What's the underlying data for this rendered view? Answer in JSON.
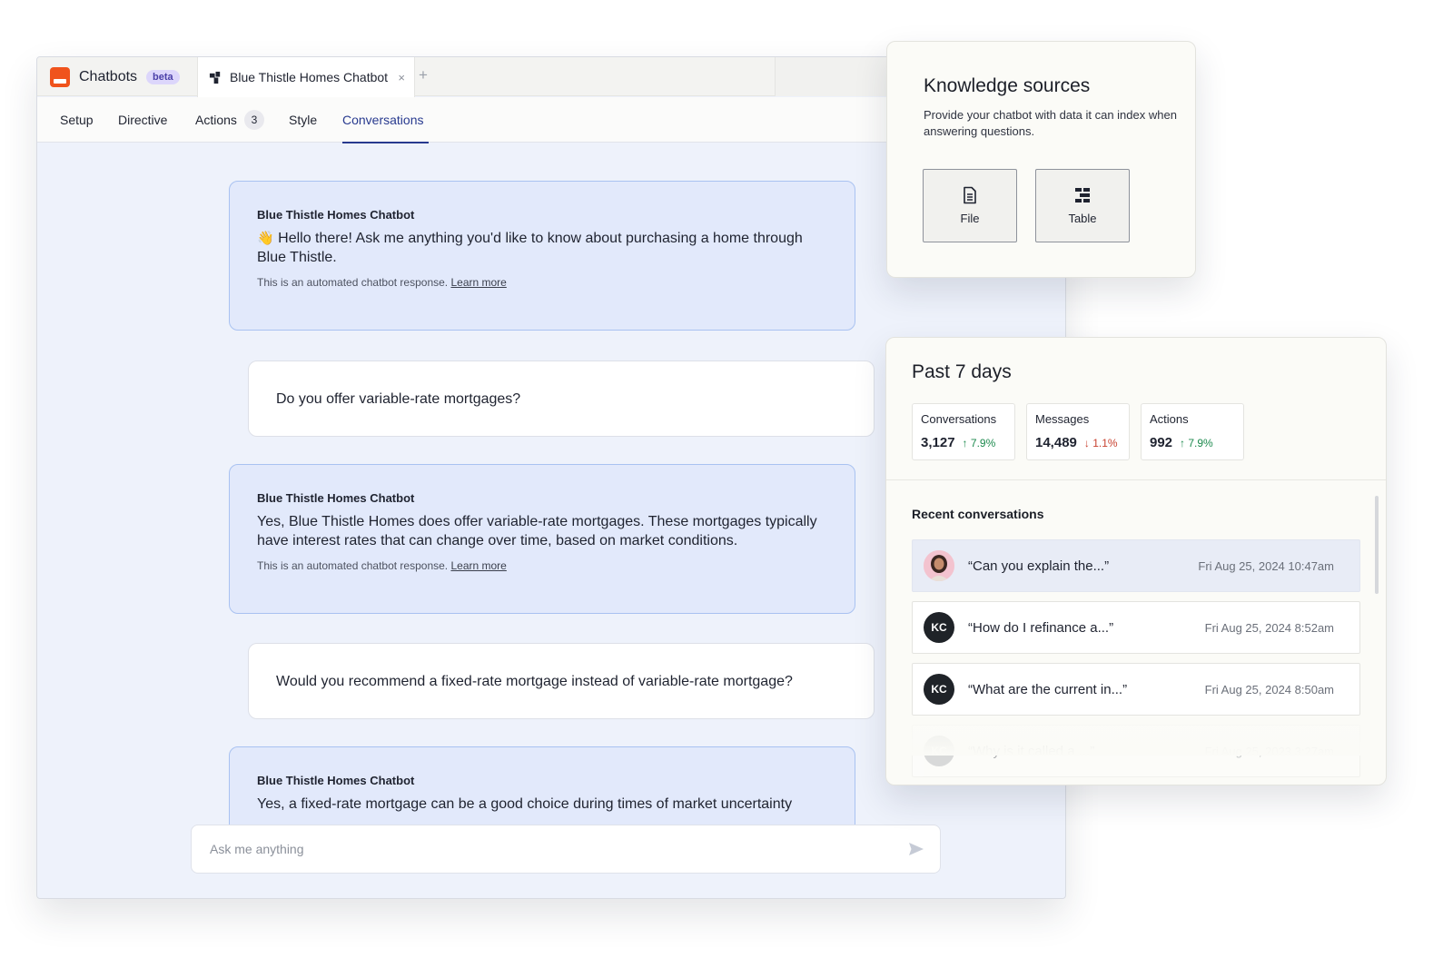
{
  "app": {
    "name": "Chatbots",
    "badge": "beta",
    "tab_title": "Blue Thistle Homes Chatbot",
    "tab_close": "×",
    "new_tab": "+"
  },
  "nav": {
    "items": [
      {
        "label": "Setup"
      },
      {
        "label": "Directive"
      },
      {
        "label": "Actions",
        "count": "3"
      },
      {
        "label": "Style"
      },
      {
        "label": "Conversations",
        "active": true
      }
    ]
  },
  "messages": [
    {
      "role": "bot",
      "sender": "Blue Thistle Homes Chatbot",
      "emoji": "👋",
      "text": "Hello there! Ask me anything you'd like to know about purchasing a home through Blue Thistle.",
      "note": "This is an automated chatbot response.",
      "note_link": "Learn more"
    },
    {
      "role": "user",
      "text": "Do you offer variable-rate mortgages?"
    },
    {
      "role": "bot",
      "sender": "Blue Thistle Homes Chatbot",
      "text": "Yes, Blue Thistle Homes does offer variable-rate mortgages. These mortgages typically have interest rates that can change over time, based on market conditions.",
      "note": "This is an automated chatbot response.",
      "note_link": "Learn more"
    },
    {
      "role": "user",
      "text": "Would you recommend a fixed-rate mortgage instead of variable-rate mortgage?"
    },
    {
      "role": "bot",
      "sender": "Blue Thistle Homes Chatbot",
      "text": "Yes, a fixed-rate mortgage can be a good choice during times of market uncertainty"
    }
  ],
  "input": {
    "placeholder": "Ask me anything"
  },
  "knowledge_sources": {
    "title": "Knowledge sources",
    "description": "Provide your chatbot with data it can index when answering questions.",
    "buttons": [
      {
        "label": "File",
        "icon": "file-icon"
      },
      {
        "label": "Table",
        "icon": "table-icon"
      }
    ]
  },
  "stats": {
    "title": "Past 7 days",
    "metrics": [
      {
        "label": "Conversations",
        "value": "3,127",
        "change": "7.9%",
        "direction": "up"
      },
      {
        "label": "Messages",
        "value": "14,489",
        "change": "1.1%",
        "direction": "down"
      },
      {
        "label": "Actions",
        "value": "992",
        "change": "7.9%",
        "direction": "up"
      }
    ],
    "recent_title": "Recent conversations",
    "recent": [
      {
        "avatar": "photo",
        "initials": "",
        "snippet": "“Can you explain the...”",
        "time": "Fri Aug 25, 2024 10:47am",
        "selected": true
      },
      {
        "avatar": "initials",
        "initials": "KC",
        "snippet": "“How do I refinance a...”",
        "time": "Fri Aug 25, 2024 8:52am"
      },
      {
        "avatar": "initials",
        "initials": "KC",
        "snippet": "“What are the current in...”",
        "time": "Fri Aug 25, 2024 8:50am"
      },
      {
        "avatar": "initials",
        "initials": "KC",
        "snippet": "“Why is it called a ...”",
        "time": "Fri Aug 25, 2023 3:27am"
      }
    ]
  },
  "colors": {
    "brand": "#f0531c",
    "accent": "#283a8f",
    "bot_bubble": "#e2e9fb",
    "up": "#1d8a4e",
    "down": "#c8412f"
  }
}
